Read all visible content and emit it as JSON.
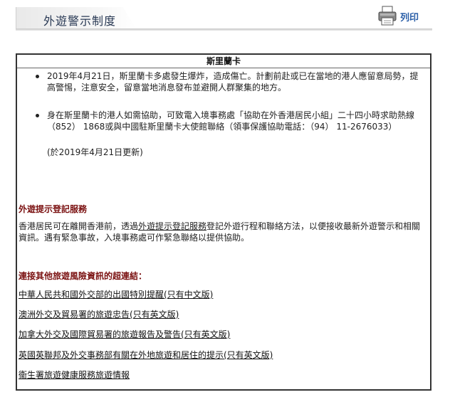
{
  "header": {
    "title": "外遊警示制度",
    "print_label": "列印"
  },
  "panel": {
    "title": "斯里蘭卡",
    "bullets": [
      "2019年4月21日，斯里蘭卡多處發生爆炸，造成傷亡。計劃前赴或已在當地的港人應留意局勢，提高警惕，注意安全，留意當地消息發布並避開人群聚集的地方。",
      "身在斯里蘭卡的港人如需協助，可致電入境事務處「協助在外香港居民小組」二十四小時求助熱線 （852） 1868或與中國駐斯里蘭卡大使館聯絡（領事保護協助電話：（94） 11-2676033）"
    ],
    "updated": "(於2019年4月21日更新)",
    "registration": {
      "heading": "外遊提示登記服務",
      "text_before": "香港居民可在離開香港前，透過",
      "text_link": "外遊提示登記服務",
      "text_after": "登記外遊行程和聯絡方法，以便接收最新外遊警示和相關資訊。遇有緊急事故，入境事務處可作緊急聯絡以提供協助。"
    },
    "links_section": {
      "heading": "連接其他旅遊風險資訊的超連結：",
      "links": [
        "中華人民共和國外交部的出國特別提醒(只有中文版)",
        "澳洲外交及貿易署的旅遊忠告(只有英文版)",
        "加拿大外交及國際貿易署的旅遊報告及警告(只有英文版)",
        "英國英聯邦及外交事務部有關在外地旅遊和居住的提示(只有英文版)",
        "衞生署旅遊健康服務旅遊情報"
      ]
    }
  }
}
